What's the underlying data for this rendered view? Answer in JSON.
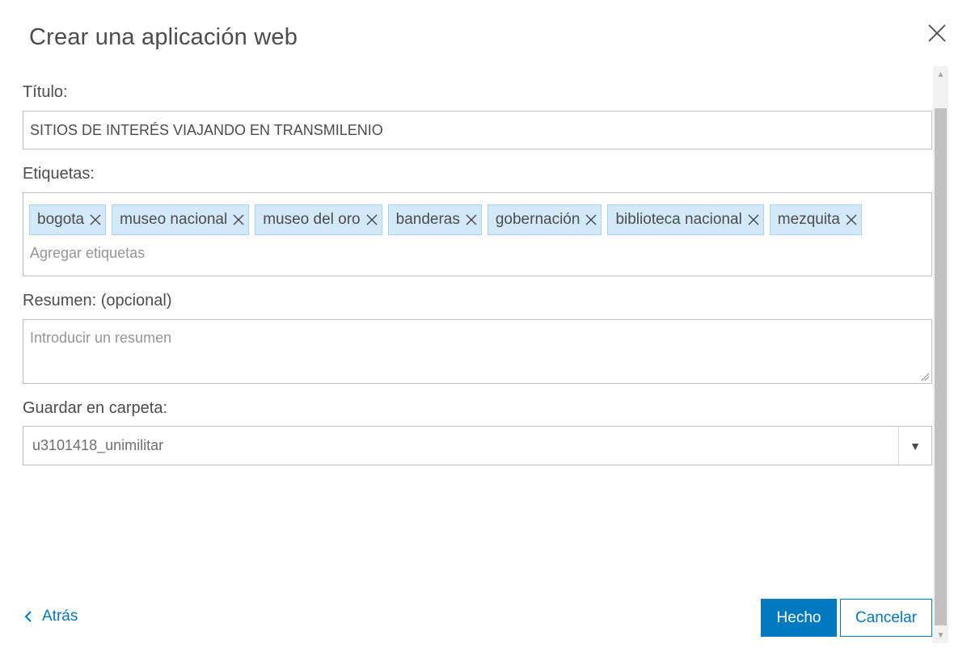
{
  "dialog": {
    "title": "Crear una aplicación web"
  },
  "form": {
    "title_label": "Título:",
    "title_value": "SITIOS DE INTERÉS VIAJANDO EN TRANSMILENIO",
    "tags_label": "Etiquetas:",
    "tags": [
      {
        "label": "bogota"
      },
      {
        "label": "museo nacional"
      },
      {
        "label": "museo del oro"
      },
      {
        "label": "banderas"
      },
      {
        "label": "gobernación"
      },
      {
        "label": "biblioteca nacional"
      },
      {
        "label": "mezquita"
      }
    ],
    "tags_placeholder": "Agregar etiquetas",
    "summary_label": "Resumen: (opcional)",
    "summary_placeholder": "Introducir un resumen",
    "folder_label": "Guardar en carpeta:",
    "folder_value": "u3101418_unimilitar"
  },
  "footer": {
    "back_label": "Atrás",
    "done_label": "Hecho",
    "cancel_label": "Cancelar"
  },
  "icons": {
    "close": "close-icon",
    "tag_remove": "close-icon",
    "back": "chevron-left-icon",
    "select": "caret-down-icon"
  },
  "colors": {
    "accent": "#0079c1",
    "tag_bg": "#d2e9f9",
    "tag_border": "#a9d2ee",
    "text": "#4c4c4c"
  }
}
